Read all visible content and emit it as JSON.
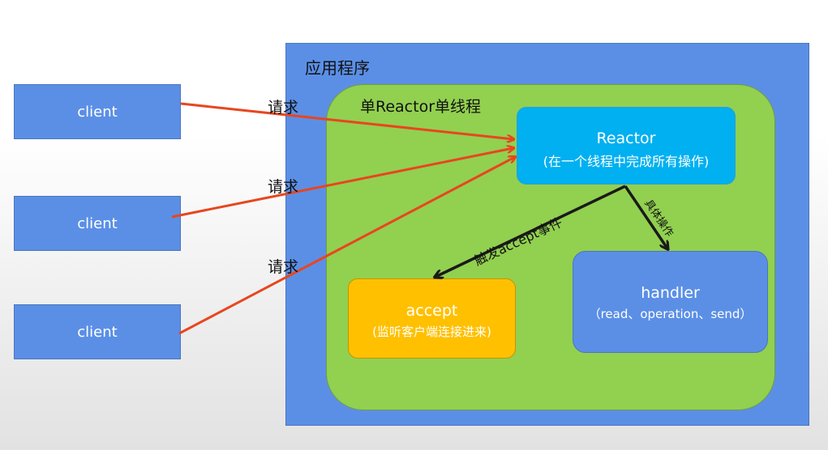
{
  "app_title": "应用程序",
  "area_title": "单Reactor单线程",
  "clients": [
    "client",
    "client",
    "client"
  ],
  "request_label": "请求",
  "reactor": {
    "title": "Reactor",
    "subtitle": "(在一个线程中完成所有操作)"
  },
  "accept": {
    "title": "accept",
    "subtitle": "(监听客户端连接进来)"
  },
  "handler": {
    "title": "handler",
    "subtitle": "（read、operation、send）"
  },
  "edges": {
    "trigger_accept": "触发accept事件",
    "specific_op": "具体操作"
  },
  "colors": {
    "app_bg": "#5b8fe6",
    "area_bg": "#92d050",
    "reactor_bg": "#00b0f0",
    "accept_bg": "#ffc000",
    "request_arrow": "#e8461f",
    "internal_arrow": "#1a1a1a"
  }
}
